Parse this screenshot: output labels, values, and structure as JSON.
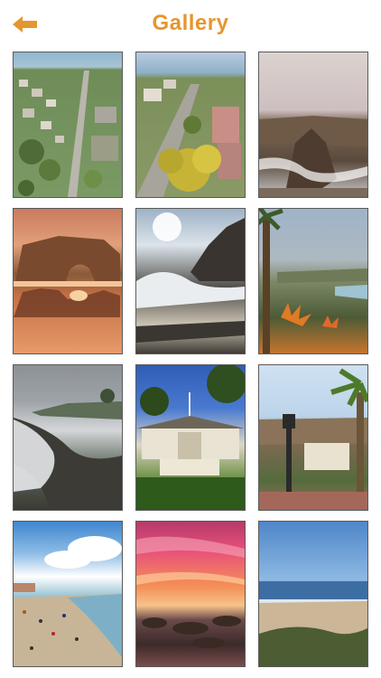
{
  "header": {
    "title": "Gallery",
    "back_icon": "arrow-left-icon",
    "accent_color": "#e6962e"
  },
  "gallery": {
    "photos": [
      {
        "subject": "aerial-neighborhood"
      },
      {
        "subject": "aerial-street-yellow-tree"
      },
      {
        "subject": "sea-cliff-rock"
      },
      {
        "subject": "natural-arch-sunset"
      },
      {
        "subject": "surf-on-rocks-sunny"
      },
      {
        "subject": "palm-trees-flowers"
      },
      {
        "subject": "cloudy-coastline"
      },
      {
        "subject": "museum-building"
      },
      {
        "subject": "courtyard-palm-lamp"
      },
      {
        "subject": "busy-beach"
      },
      {
        "subject": "pink-sunset-tidepools"
      },
      {
        "subject": "calm-beach-ocean"
      }
    ]
  }
}
